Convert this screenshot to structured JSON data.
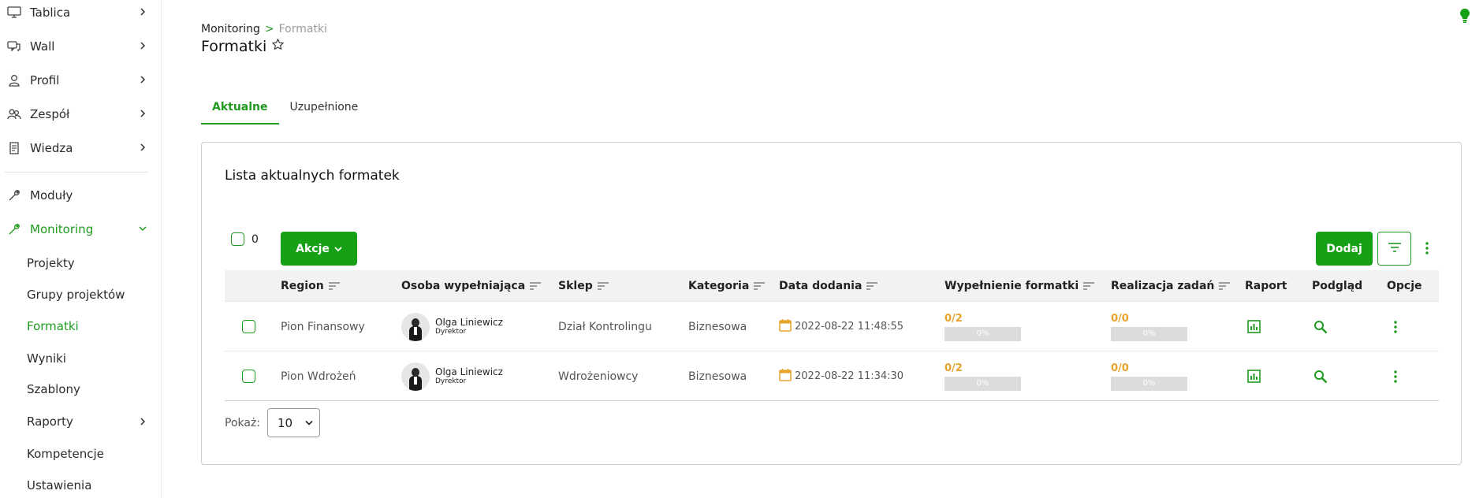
{
  "sidebar": {
    "items": [
      {
        "label": "Tablica",
        "icon": "monitor-icon"
      },
      {
        "label": "Wall",
        "icon": "chat-icon"
      },
      {
        "label": "Profil",
        "icon": "user-icon"
      },
      {
        "label": "Zespół",
        "icon": "team-icon"
      },
      {
        "label": "Wiedza",
        "icon": "document-icon"
      },
      {
        "label": "Moduły",
        "icon": "wrench-icon"
      },
      {
        "label": "Monitoring",
        "icon": "wrench-icon"
      }
    ],
    "monitoring_sub": [
      {
        "label": "Projekty"
      },
      {
        "label": "Grupy projektów"
      },
      {
        "label": "Formatki"
      },
      {
        "label": "Wyniki"
      },
      {
        "label": "Szablony"
      },
      {
        "label": "Raporty"
      },
      {
        "label": "Kompetencje"
      },
      {
        "label": "Ustawienia"
      }
    ]
  },
  "header": {
    "breadcrumb_root": "Monitoring",
    "breadcrumb_sep": ">",
    "breadcrumb_current": "Formatki",
    "title": "Formatki"
  },
  "tabs": [
    {
      "label": "Aktualne",
      "active": true
    },
    {
      "label": "Uzupełnione",
      "active": false
    }
  ],
  "card": {
    "title": "Lista aktualnych formatek",
    "selected_count": "0",
    "actions_label": "Akcje",
    "add_label": "Dodaj"
  },
  "table": {
    "columns": [
      "Region",
      "Osoba wypełniająca",
      "Sklep",
      "Kategoria",
      "Data dodania",
      "Wypełnienie formatki",
      "Realizacja zadań",
      "Raport",
      "Podgląd",
      "Opcje"
    ],
    "rows": [
      {
        "region": "Pion Finansowy",
        "person_name": "Olga Liniewicz",
        "person_role": "Dyrektor",
        "shop": "Dział Kontrolingu",
        "category": "Biznesowa",
        "date": "2022-08-22 11:48:55",
        "fill_count": "0/2",
        "fill_pct": "0%",
        "tasks_count": "0/0",
        "tasks_pct": "0%"
      },
      {
        "region": "Pion Wdrożeń",
        "person_name": "Olga Liniewicz",
        "person_role": "Dyrektor",
        "shop": "Wdrożeniowcy",
        "category": "Biznesowa",
        "date": "2022-08-22 11:34:30",
        "fill_count": "0/2",
        "fill_pct": "0%",
        "tasks_count": "0/0",
        "tasks_pct": "0%"
      }
    ]
  },
  "pagination": {
    "show_label": "Pokaż:",
    "page_size": "10"
  },
  "colors": {
    "accent": "#16a016",
    "progress_count": "#e8a32a",
    "progress_bar": "#dcdcdc"
  }
}
